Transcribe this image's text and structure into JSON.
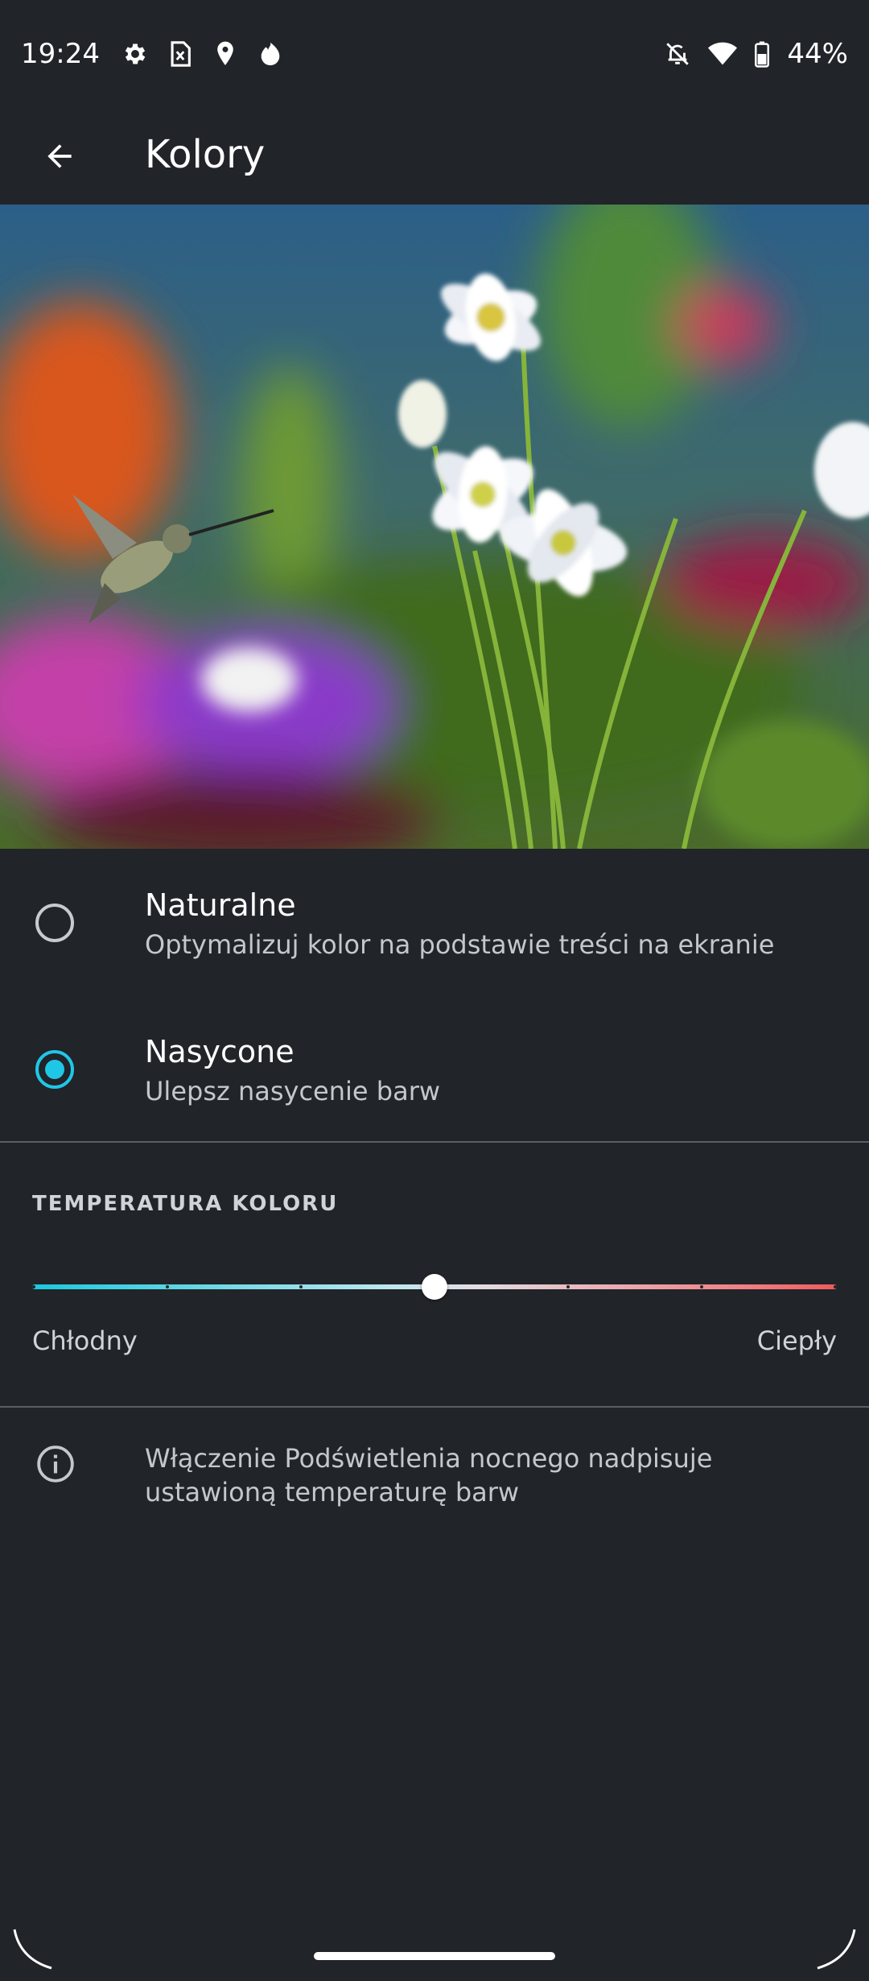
{
  "status_bar": {
    "time": "19:24",
    "left_icons": [
      "gear-icon",
      "sim-card-icon",
      "location-pin-icon",
      "fire-icon"
    ],
    "right_icons": [
      "notifications-off-icon",
      "wifi-icon",
      "battery-icon"
    ],
    "battery": "44%"
  },
  "app_bar": {
    "title": "Kolory",
    "back_icon": "arrow-back-icon"
  },
  "options": [
    {
      "title": "Naturalne",
      "subtitle": "Optymalizuj kolor na podstawie treści na ekranie",
      "selected": false
    },
    {
      "title": "Nasycone",
      "subtitle": "Ulepsz nasycenie barw",
      "selected": true
    }
  ],
  "temperature": {
    "header": "TEMPERATURA KOLORU",
    "min_label": "Chłodny",
    "max_label": "Ciepły",
    "value_fraction": 0.5,
    "tick_count": 7
  },
  "info": {
    "text": "Włączenie Podświetlenia nocnego nadpisuje ustawioną temperaturę barw"
  },
  "colors": {
    "background": "#212429",
    "accent": "#1fc7e6"
  }
}
